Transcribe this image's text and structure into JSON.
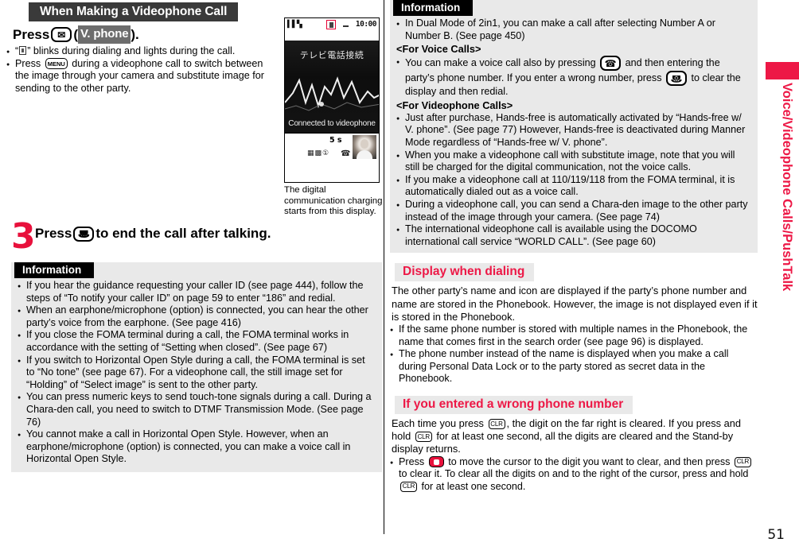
{
  "page": {
    "number": "51",
    "side_tab_text": "Voice/Videophone Calls/PushTalk"
  },
  "left": {
    "section_title": "When Making a Videophone Call",
    "step2": {
      "press_label": "Press",
      "key_glyph": "envelope-key",
      "paren_open": "(",
      "inverse_label": "V. phone",
      "paren_close": ")."
    },
    "lead_bullets": [
      {
        "pre": "“",
        "icon": "videophone-indicator-icon",
        "post": "” blinks during dialing and lights during the call."
      },
      {
        "pre": "Press",
        "icon": "menu-key",
        "post": "during a videophone call to switch between the image through your camera and substitute image for sending to the other party."
      }
    ],
    "phone": {
      "status_signal": "signal-bars-icon",
      "status_videophone_icon": "videophone-icon",
      "status_time": "10:00",
      "video_caption_jp": "テレビ電話接続",
      "video_caption_en": "Connected to videophone",
      "timer": "5 s",
      "soft_icons": "function-icons",
      "hand_icon": "handset-icon",
      "face": "caller-photo"
    },
    "phone_caption": "The digital communication charging starts from this display.",
    "step3": {
      "number": "3",
      "pre": "Press",
      "key_glyph": "end-call-key",
      "post": "to end the call after talking."
    },
    "information": {
      "heading": "Information",
      "items": [
        "If you hear the guidance requesting your caller ID (see page 444), follow the steps of “To notify your caller ID” on page 59 to enter “186” and redial.",
        "When an earphone/microphone (option) is connected, you can hear the other party’s voice from the earphone. (See page 416)",
        "If you close the FOMA terminal during a call, the FOMA terminal works in accordance with the setting of “Setting when closed”. (See page 67)",
        "If you switch to Horizontal Open Style during a call, the FOMA terminal is set to “No tone” (see page 67). For a videophone call, the still image set for “Holding” of “Select image” is sent to the other party.",
        "You can press numeric keys to send touch-tone signals during a call. During a Chara-den call, you need to switch to DTMF Transmission Mode. (See page 76)",
        "You cannot make a call in Horizontal Open Style. However, when an earphone/microphone (option) is connected, you can make a voice call in Horizontal Open Style."
      ]
    }
  },
  "right": {
    "information": {
      "heading": "Information",
      "item_dual_mode": "In Dual Mode of 2in1, you can make a call after selecting Number A or Number B. (See page 450)",
      "subheading_voice": "<For Voice Calls>",
      "voice_item": {
        "part1": "You can make a voice call also by pressing",
        "key1": "call-key",
        "part2": "and then entering the party’s phone number. If you enter a wrong number, press",
        "key2": "end-call-key",
        "part3": "to clear the display and then redial."
      },
      "subheading_videophone": "<For Videophone Calls>",
      "videophone_items": [
        "Just after purchase, Hands-free is automatically activated by “Hands-free w/ V. phone”. (See page 77) However, Hands-free is deactivated during Manner Mode regardless of “Hands-free w/ V. phone”.",
        "When you make a videophone call with substitute image, note that you will still be charged for the digital communication, not the voice calls.",
        "If you make a videophone call at 110/119/118 from the FOMA terminal, it is automatically dialed out as a voice call.",
        "During a videophone call, you can send a Chara-den image to the other party instead of the image through your camera. (See page 74)",
        "The international videophone call is available using the DOCOMO international call service “WORLD CALL”. (See page 60)"
      ]
    },
    "display_when_dialing": {
      "heading": "Display when dialing",
      "paragraph": "The other party’s name and icon are displayed if the party’s phone number and name are stored in the Phonebook. However, the image is not displayed even if it is stored in the Phonebook.",
      "bullets": [
        "If the same phone number is stored with multiple names in the Phonebook, the name that comes first in the search order (see page 96) is displayed.",
        "The phone number instead of the name is displayed when you make a call during Personal Data Lock or to the party stored as secret data in the Phonebook."
      ]
    },
    "wrong_number": {
      "heading": "If you entered a wrong phone number",
      "p1_part1": "Each time you press",
      "p1_key1": "CLR",
      "p1_part2": ", the digit on the far right is cleared. If you press and hold",
      "p1_key2": "CLR",
      "p1_part3": "for at least one second, all the digits are cleared and the Stand-by display returns.",
      "bullet": {
        "part1": "Press",
        "key1": "direction-key",
        "part2": "to move the cursor to the digit you want to clear, and then press",
        "key2": "CLR",
        "part3": "to clear it. To clear all the digits on and to the right of the cursor, press and hold",
        "key3": "CLR",
        "part4": "for at least one second."
      }
    }
  },
  "colors": {
    "red": "#ed1846",
    "step_red": "#e8113c",
    "info_bg": "#e9e9e9",
    "dark_bar": "#3a3a3a"
  }
}
